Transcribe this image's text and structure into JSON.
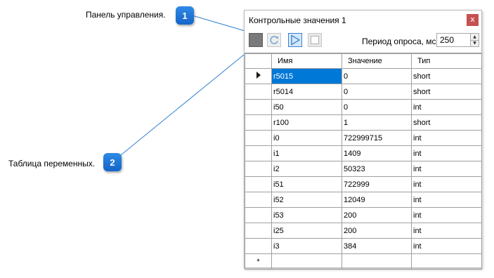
{
  "callouts": [
    {
      "number": "1",
      "text": "Панель управления."
    },
    {
      "number": "2",
      "text": "Таблица переменных."
    }
  ],
  "window": {
    "title": "Контрольные значения 1",
    "close_label": "x"
  },
  "toolbar": {
    "buttons": [
      {
        "name": "stop",
        "icon": "stop-square-icon"
      },
      {
        "name": "refresh",
        "icon": "refresh-icon"
      },
      {
        "name": "play",
        "icon": "play-icon"
      },
      {
        "name": "square",
        "icon": "empty-square-icon"
      }
    ],
    "period_label": "Период опроса, мс",
    "period_value": "250"
  },
  "table": {
    "columns": [
      "Имя",
      "Значение",
      "Тип"
    ],
    "rows": [
      {
        "name": "r5015",
        "value": "0",
        "type": "short"
      },
      {
        "name": "r5014",
        "value": "0",
        "type": "short"
      },
      {
        "name": "i50",
        "value": "0",
        "type": "int"
      },
      {
        "name": "r100",
        "value": "1",
        "type": "short"
      },
      {
        "name": "i0",
        "value": "722999715",
        "type": "int"
      },
      {
        "name": "i1",
        "value": "1409",
        "type": "int"
      },
      {
        "name": "i2",
        "value": "50323",
        "type": "int"
      },
      {
        "name": "i51",
        "value": "722999",
        "type": "int"
      },
      {
        "name": "i52",
        "value": "12049",
        "type": "int"
      },
      {
        "name": "i53",
        "value": "200",
        "type": "int"
      },
      {
        "name": "i25",
        "value": "200",
        "type": "int"
      },
      {
        "name": "i3",
        "value": "384",
        "type": "int"
      }
    ],
    "new_row_marker": "*",
    "selected_row": 0
  },
  "colors": {
    "badge": "#1f78d1",
    "selection": "#0078d7",
    "close": "#c75050",
    "callout_line": "#2d7fd3"
  }
}
